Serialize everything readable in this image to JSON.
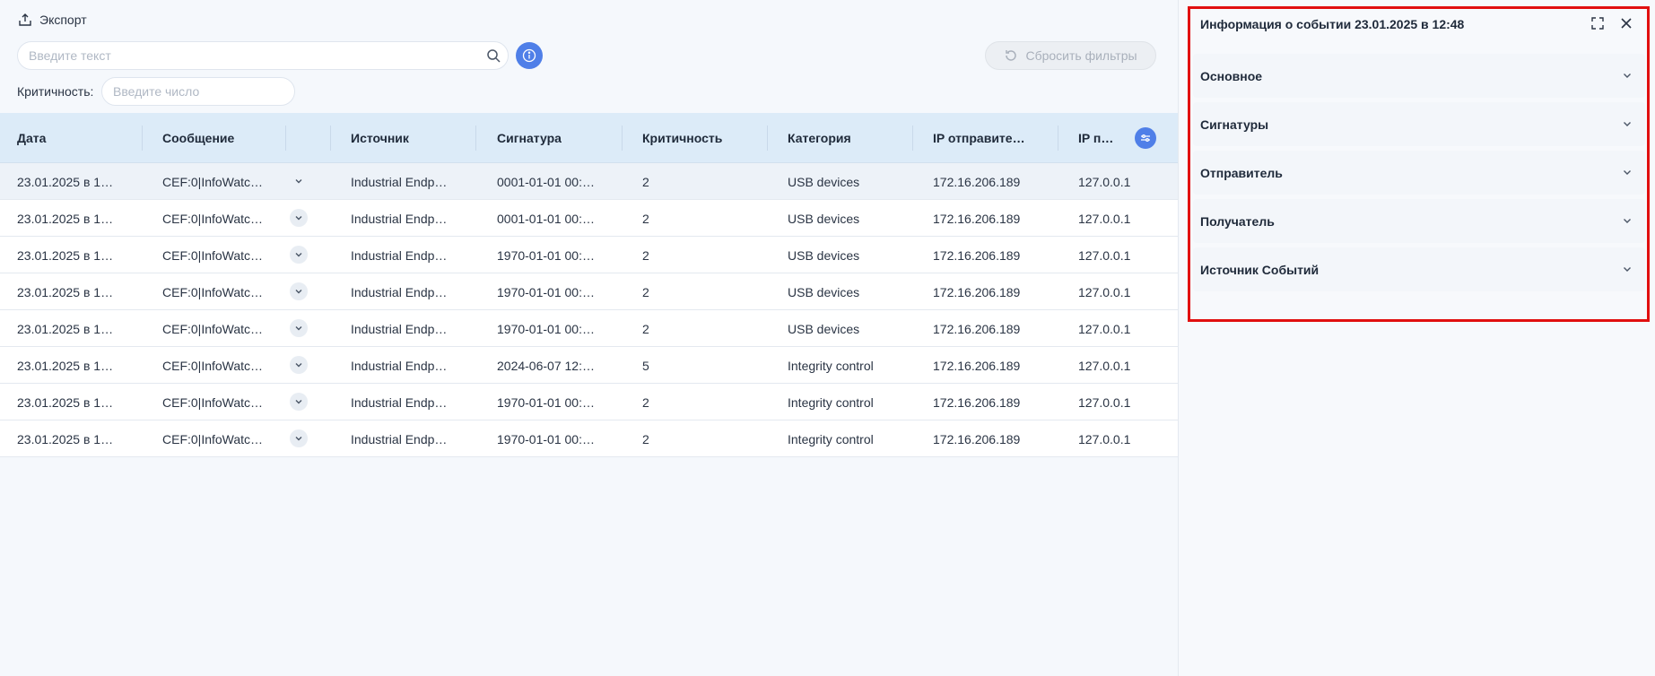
{
  "toolbar": {
    "export_label": "Экспорт",
    "search_placeholder": "Введите текст",
    "reset_label": "Сбросить фильтры",
    "criticality_label": "Критичность:",
    "criticality_placeholder": "Введите число"
  },
  "table": {
    "columns": [
      "Дата",
      "Сообщение",
      "Источник",
      "Сигнатура",
      "Критичность",
      "Категория",
      "IP отправите…",
      "IP п…"
    ],
    "rows": [
      {
        "date": "23.01.2025 в 1…",
        "message": "CEF:0|InfoWatc…",
        "source": "Industrial Endp…",
        "signature": "0001-01-01 00:…",
        "criticality": "2",
        "category": "USB devices",
        "ip_sender": "172.16.206.189",
        "ip_recv": "127.0.0.1"
      },
      {
        "date": "23.01.2025 в 1…",
        "message": "CEF:0|InfoWatc…",
        "source": "Industrial Endp…",
        "signature": "0001-01-01 00:…",
        "criticality": "2",
        "category": "USB devices",
        "ip_sender": "172.16.206.189",
        "ip_recv": "127.0.0.1"
      },
      {
        "date": "23.01.2025 в 1…",
        "message": "CEF:0|InfoWatc…",
        "source": "Industrial Endp…",
        "signature": "1970-01-01 00:…",
        "criticality": "2",
        "category": "USB devices",
        "ip_sender": "172.16.206.189",
        "ip_recv": "127.0.0.1"
      },
      {
        "date": "23.01.2025 в 1…",
        "message": "CEF:0|InfoWatc…",
        "source": "Industrial Endp…",
        "signature": "1970-01-01 00:…",
        "criticality": "2",
        "category": "USB devices",
        "ip_sender": "172.16.206.189",
        "ip_recv": "127.0.0.1"
      },
      {
        "date": "23.01.2025 в 1…",
        "message": "CEF:0|InfoWatc…",
        "source": "Industrial Endp…",
        "signature": "1970-01-01 00:…",
        "criticality": "2",
        "category": "USB devices",
        "ip_sender": "172.16.206.189",
        "ip_recv": "127.0.0.1"
      },
      {
        "date": "23.01.2025 в 1…",
        "message": "CEF:0|InfoWatc…",
        "source": "Industrial Endp…",
        "signature": "2024-06-07 12:…",
        "criticality": "5",
        "category": "Integrity control",
        "ip_sender": "172.16.206.189",
        "ip_recv": "127.0.0.1"
      },
      {
        "date": "23.01.2025 в 1…",
        "message": "CEF:0|InfoWatc…",
        "source": "Industrial Endp…",
        "signature": "1970-01-01 00:…",
        "criticality": "2",
        "category": "Integrity control",
        "ip_sender": "172.16.206.189",
        "ip_recv": "127.0.0.1"
      },
      {
        "date": "23.01.2025 в 1…",
        "message": "CEF:0|InfoWatc…",
        "source": "Industrial Endp…",
        "signature": "1970-01-01 00:…",
        "criticality": "2",
        "category": "Integrity control",
        "ip_sender": "172.16.206.189",
        "ip_recv": "127.0.0.1"
      }
    ]
  },
  "panel": {
    "title": "Информация о событии 23.01.2025 в 12:48",
    "sections": [
      "Основное",
      "Сигнатуры",
      "Отправитель",
      "Получатель",
      "Источник Событий"
    ]
  },
  "colors": {
    "accent": "#4f7fe8",
    "highlight_frame": "#e10f0f",
    "header_bg": "#dcebf8"
  }
}
